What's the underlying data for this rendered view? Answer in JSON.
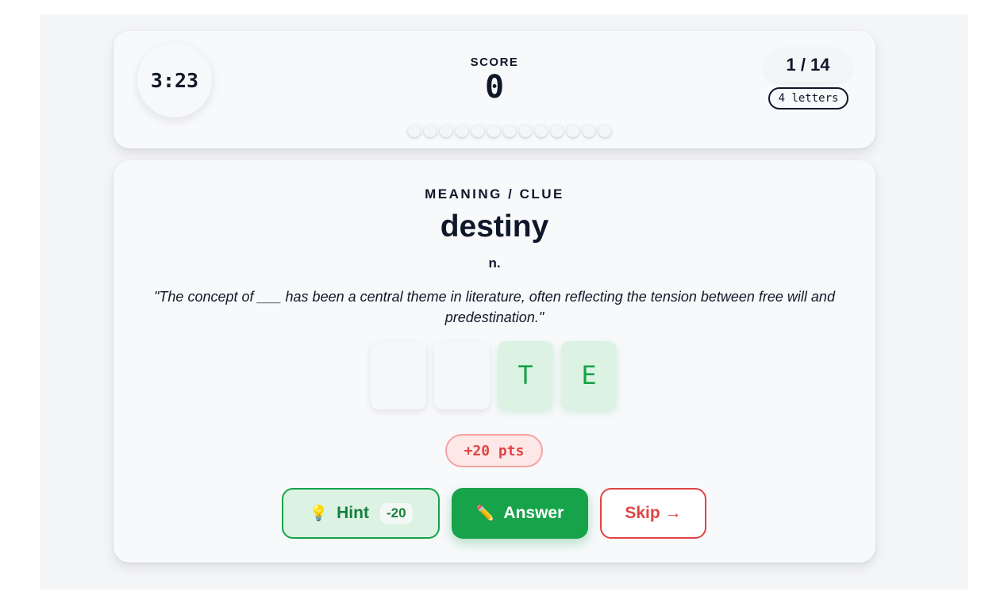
{
  "header": {
    "timer": "3:23",
    "score_label": "SCORE",
    "score_value": "0",
    "progress": "1 / 14",
    "letters_badge": "4 letters",
    "progress_dots_total": 13,
    "progress_dots_completed": 0
  },
  "clue": {
    "label": "MEANING / CLUE",
    "word": "destiny",
    "part_of_speech": "n.",
    "sentence": "\"The concept of ___ has been a central theme in literature, often reflecting the tension between free will and predestination.\""
  },
  "tiles": [
    {
      "letter": "",
      "revealed": false
    },
    {
      "letter": "",
      "revealed": false
    },
    {
      "letter": "T",
      "revealed": true
    },
    {
      "letter": "E",
      "revealed": true
    }
  ],
  "points_badge": "+20 pts",
  "buttons": {
    "hint_icon": "lightbulb-icon",
    "hint_label": "Hint",
    "hint_cost": "-20",
    "answer_icon": "pencil-icon",
    "answer_label": "Answer",
    "skip_label": "Skip",
    "skip_icon": "arrow-right-icon"
  },
  "colors": {
    "accent_green": "#16a34a",
    "danger_red": "#e04444",
    "text_dark": "#0f172a"
  }
}
